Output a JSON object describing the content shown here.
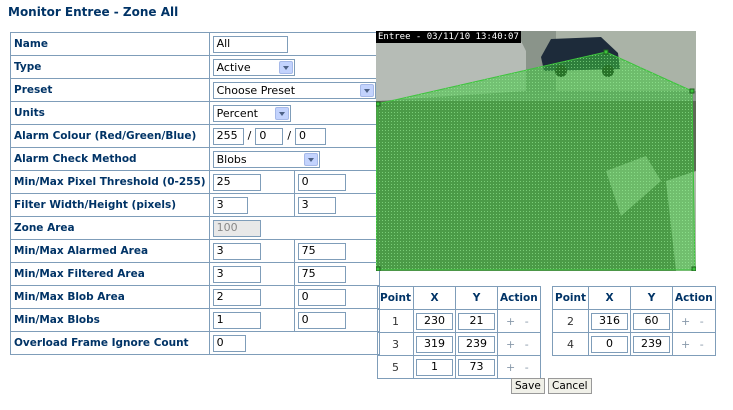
{
  "page_title": "Monitor Entree - Zone All",
  "form": {
    "name": {
      "label": "Name",
      "value": "All"
    },
    "type": {
      "label": "Type",
      "value": "Active"
    },
    "preset": {
      "label": "Preset",
      "value": "Choose Preset"
    },
    "units": {
      "label": "Units",
      "value": "Percent"
    },
    "alarm_colour": {
      "label": "Alarm Colour (Red/Green/Blue)",
      "red": "255",
      "green": "0",
      "blue": "0"
    },
    "alarm_check_method": {
      "label": "Alarm Check Method",
      "value": "Blobs"
    },
    "pixel_threshold": {
      "label": "Min/Max Pixel Threshold (0-255)",
      "min": "25",
      "max": "0"
    },
    "filter_size": {
      "label": "Filter Width/Height (pixels)",
      "width": "3",
      "height": "3"
    },
    "zone_area": {
      "label": "Zone Area",
      "value": "100"
    },
    "alarmed_area": {
      "label": "Min/Max Alarmed Area",
      "min": "3",
      "max": "75"
    },
    "filtered_area": {
      "label": "Min/Max Filtered Area",
      "min": "3",
      "max": "75"
    },
    "blob_area": {
      "label": "Min/Max Blob Area",
      "min": "2",
      "max": "0"
    },
    "blobs": {
      "label": "Min/Max Blobs",
      "min": "1",
      "max": "0"
    },
    "overload_ignore": {
      "label": "Overload Frame Ignore Count",
      "value": "0"
    }
  },
  "camera": {
    "timestamp": "Entree - 03/11/10 13:40:07",
    "zone_color": "#3cc43c"
  },
  "points_headers": {
    "point": "Point",
    "x": "X",
    "y": "Y",
    "action": "Action"
  },
  "points_left": [
    {
      "point": "1",
      "x": "230",
      "y": "21",
      "action": "+ -"
    },
    {
      "point": "3",
      "x": "319",
      "y": "239",
      "action": "+ -"
    },
    {
      "point": "5",
      "x": "1",
      "y": "73",
      "action": "+ -"
    }
  ],
  "points_right": [
    {
      "point": "2",
      "x": "316",
      "y": "60",
      "action": "+ -"
    },
    {
      "point": "4",
      "x": "0",
      "y": "239",
      "action": "+ -"
    }
  ],
  "buttons": {
    "save": "Save",
    "cancel": "Cancel"
  }
}
